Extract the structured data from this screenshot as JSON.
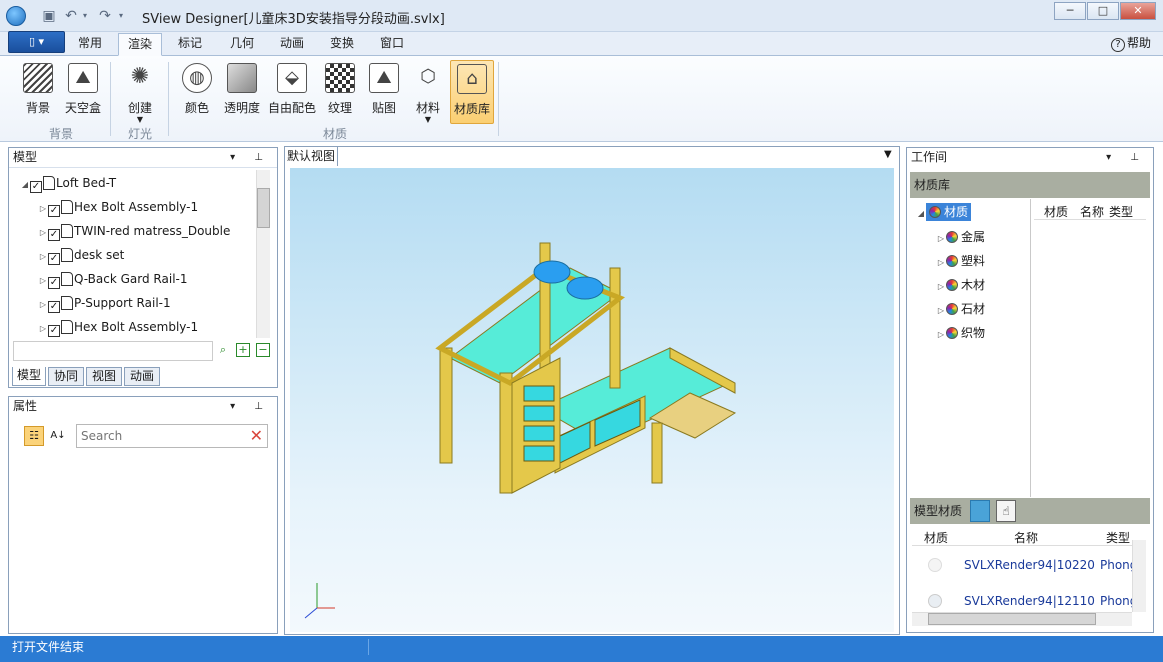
{
  "titlebar": {
    "title": "SView Designer[儿童床3D安装指导分段动画.svlx]",
    "min": "─",
    "max": "□",
    "close": "✕"
  },
  "menu": {
    "tabs": [
      "常用",
      "渲染",
      "标记",
      "几何",
      "动画",
      "变换",
      "窗口"
    ],
    "active": "渲染",
    "help": "帮助",
    "file_icon": "new-file-icon"
  },
  "ribbon": {
    "background": {
      "label": "背景",
      "items": [
        "背景",
        "天空盒"
      ]
    },
    "light": {
      "label": "灯光",
      "items": [
        "创建"
      ]
    },
    "material": {
      "label": "材质",
      "items": [
        "颜色",
        "透明度",
        "自由配色",
        "纹理",
        "贴图",
        "材料",
        "材质库"
      ]
    }
  },
  "model_panel": {
    "title": "模型",
    "tree": [
      {
        "label": "Loft Bed-T",
        "level": 0,
        "expanded": true
      },
      {
        "label": "Hex Bolt Assembly-1",
        "level": 1
      },
      {
        "label": "TWIN-red matress_Double",
        "level": 1
      },
      {
        "label": "desk set",
        "level": 1
      },
      {
        "label": "Q-Back Gard Rail-1",
        "level": 1
      },
      {
        "label": "P-Support Rail-1",
        "level": 1
      },
      {
        "label": "Hex Bolt Assembly-1",
        "level": 1
      }
    ],
    "tabs": [
      "模型",
      "协同",
      "视图",
      "动画"
    ],
    "active_tab": "模型"
  },
  "props_panel": {
    "title": "属性",
    "search_placeholder": "Search"
  },
  "viewport": {
    "tab": "默认视图"
  },
  "work_panel": {
    "title": "工作间",
    "library_title": "材质库",
    "tree": [
      {
        "label": "材质",
        "level": 0,
        "selected": true
      },
      {
        "label": "金属",
        "level": 1
      },
      {
        "label": "塑料",
        "level": 1
      },
      {
        "label": "木材",
        "level": 1
      },
      {
        "label": "石材",
        "level": 1
      },
      {
        "label": "织物",
        "level": 1
      }
    ],
    "columns": [
      "材质",
      "名称",
      "类型"
    ],
    "model_material_title": "模型材质",
    "mm_columns": [
      "材质",
      "名称",
      "类型"
    ],
    "mm_rows": [
      {
        "name": "SVLXRender94|10220",
        "type": "Phong"
      },
      {
        "name": "SVLXRender94|12110",
        "type": "Phong"
      }
    ]
  },
  "status": {
    "text": "打开文件结束"
  }
}
